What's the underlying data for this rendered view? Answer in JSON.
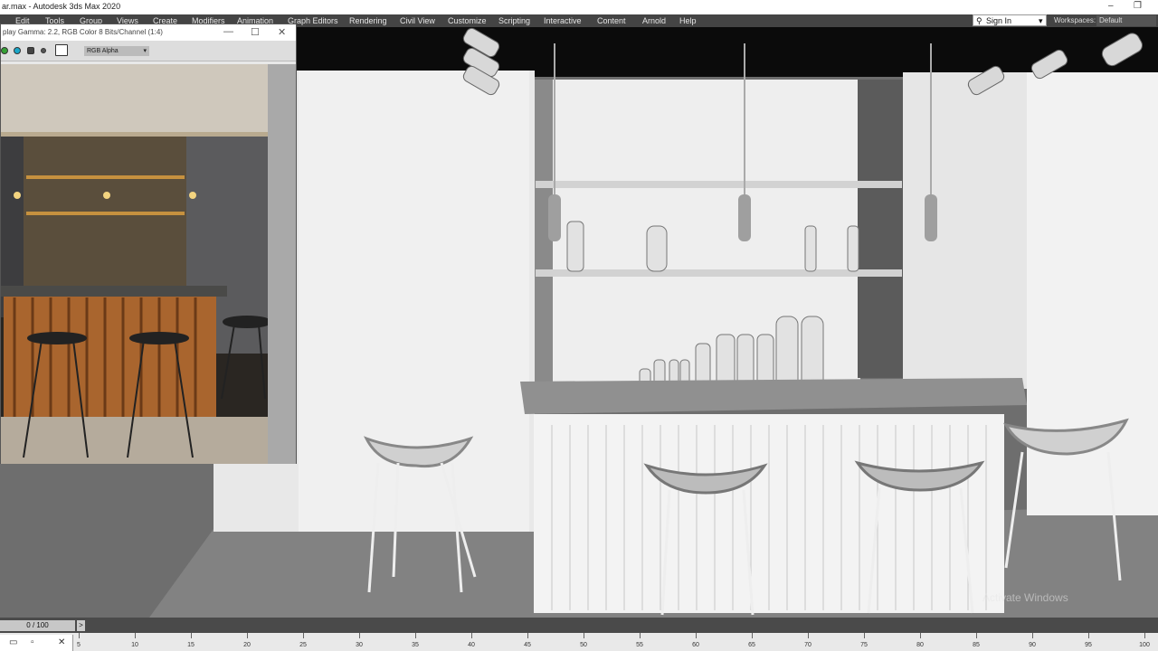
{
  "window": {
    "title": "ar.max - Autodesk 3ds Max 2020",
    "minimize": "–",
    "restore": "❐"
  },
  "menu": [
    "Edit",
    "Tools",
    "Group",
    "Views",
    "Create",
    "Modifiers",
    "Animation",
    "Graph Editors",
    "Rendering",
    "Civil View",
    "Customize",
    "Scripting",
    "Interactive",
    "Content",
    "Arnold",
    "Help"
  ],
  "account": {
    "label": "Sign In",
    "arrow": "▾"
  },
  "workspaces": {
    "label": "Workspaces:",
    "value": "Default"
  },
  "frame_buffer": {
    "caption": "play Gamma: 2.2, RGB Color 8 Bits/Channel (1:4)",
    "channel": "RGB Alpha",
    "minimize": "—",
    "maximize": "☐",
    "close": "✕",
    "swatch_colors": [
      "#35a035",
      "#1aa7c9",
      "#444444",
      "#e0e0e0",
      "#ffffff"
    ]
  },
  "timeline": {
    "frame": "0 / 100",
    "next": ">"
  },
  "ruler": {
    "ticks": [
      "5",
      "10",
      "15",
      "20",
      "25",
      "30",
      "35",
      "40",
      "45",
      "50",
      "55",
      "60",
      "65",
      "70",
      "75",
      "80",
      "85",
      "90",
      "95",
      "100"
    ]
  },
  "watermark": "Activate Windows",
  "mini_controls": {
    "a": "▭",
    "b": "✕"
  }
}
